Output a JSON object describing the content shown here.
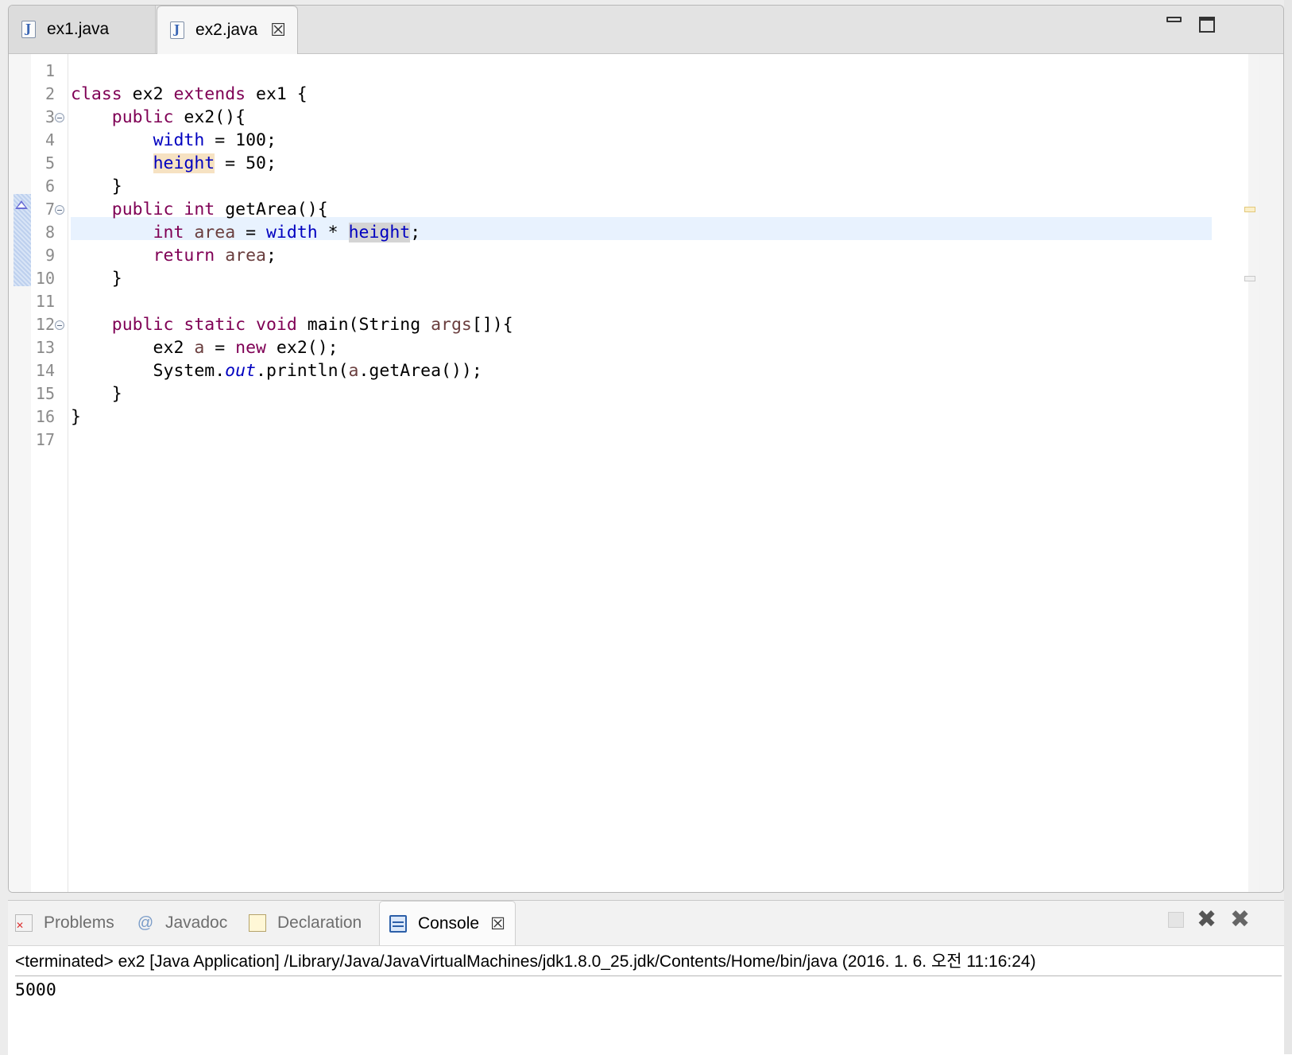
{
  "editor": {
    "tabs": [
      {
        "label": "ex1.java",
        "active": false,
        "icon": "java-file-icon"
      },
      {
        "label": "ex2.java",
        "active": true,
        "icon": "java-file-icon",
        "close": "☒"
      }
    ],
    "line_numbers": [
      "1",
      "2",
      "3",
      "4",
      "5",
      "6",
      "7",
      "8",
      "9",
      "10",
      "11",
      "12",
      "13",
      "14",
      "15",
      "16",
      "17"
    ],
    "folded_lines": [
      "3",
      "7",
      "12"
    ],
    "current_line": "8",
    "colors": {
      "keyword": "#7f0055",
      "field": "#0000c0",
      "local": "#6a3e3e",
      "current_line_bg": "#e8f2fe",
      "occurrence_write": "#f6e2c2",
      "occurrence_read": "#d4d4d4"
    }
  },
  "code": {
    "l2": {
      "t1": "class",
      "t2": " ex2 ",
      "t3": "extends",
      "t4": " ex1 {"
    },
    "l3": {
      "t1": "    ",
      "t2": "public",
      "t3": " ex2(){"
    },
    "l4": {
      "t1": "        ",
      "t2": "width",
      "t3": " = 100;"
    },
    "l5": {
      "t1": "        ",
      "t2": "height",
      "t3": " = 50;"
    },
    "l6": {
      "t1": "    }"
    },
    "l7": {
      "t1": "    ",
      "t2": "public",
      "t3": " ",
      "t4": "int",
      "t5": " getArea(){"
    },
    "l8": {
      "t1": "        ",
      "t2": "int",
      "t3": " ",
      "t4": "area",
      "t5": " = ",
      "t6": "width",
      "t7": " * ",
      "t8": "height",
      "t9": ";"
    },
    "l9": {
      "t1": "        ",
      "t2": "return",
      "t3": " ",
      "t4": "area",
      "t5": ";"
    },
    "l10": {
      "t1": "    }"
    },
    "l12": {
      "t1": "    ",
      "t2": "public",
      "t3": " ",
      "t4": "static",
      "t5": " ",
      "t6": "void",
      "t7": " main(String ",
      "t8": "args",
      "t9": "[]){"
    },
    "l13": {
      "t1": "        ex2 ",
      "t2": "a",
      "t3": " = ",
      "t4": "new",
      "t5": " ex2();"
    },
    "l14": {
      "t1": "        System.",
      "t2": "out",
      "t3": ".println(",
      "t4": "a",
      "t5": ".getArea());"
    },
    "l15": {
      "t1": "    }"
    },
    "l16": {
      "t1": "}"
    }
  },
  "bottom_panel": {
    "tabs": [
      {
        "label": "Problems",
        "icon": "problems-icon"
      },
      {
        "label": "Javadoc",
        "icon": "javadoc-icon",
        "glyph": "@"
      },
      {
        "label": "Declaration",
        "icon": "declaration-icon"
      },
      {
        "label": "Console",
        "icon": "console-icon",
        "active": true,
        "close": "☒"
      }
    ],
    "console_header": "<terminated> ex2 [Java Application] /Library/Java/JavaVirtualMachines/jdk1.8.0_25.jdk/Contents/Home/bin/java (2016. 1. 6. 오전 11:16:24)",
    "console_output": "5000",
    "toolbar": {
      "remove": "✖",
      "remove_all": "✖"
    }
  }
}
